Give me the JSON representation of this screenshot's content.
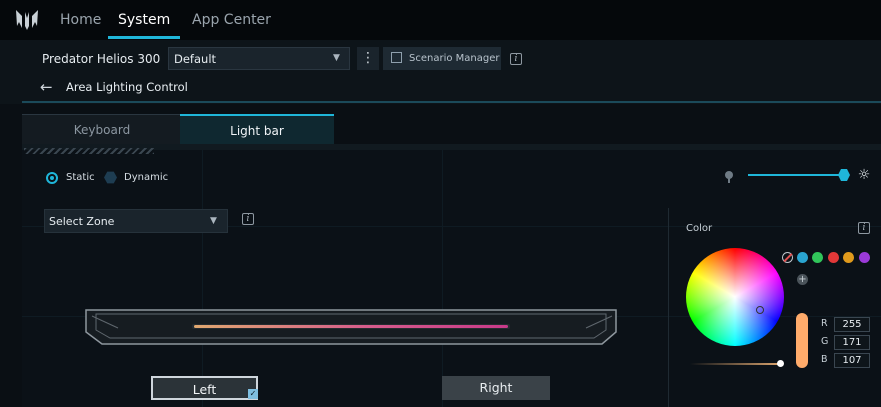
{
  "nav": {
    "tabs": [
      {
        "label": "Home"
      },
      {
        "label": "System"
      },
      {
        "label": "App Center"
      }
    ],
    "active": "System"
  },
  "device": {
    "name": "Predator Helios 300",
    "profile": "Default",
    "scenario_manager": "Scenario Manager"
  },
  "page": {
    "title": "Area Lighting Control"
  },
  "tabs": [
    {
      "label": "Keyboard"
    },
    {
      "label": "Light bar"
    }
  ],
  "active_tab": "Light bar",
  "mode": {
    "options": [
      {
        "label": "Static",
        "selected": true
      },
      {
        "label": "Dynamic",
        "selected": false
      }
    ]
  },
  "brightness": {
    "level": 1.0
  },
  "zone": {
    "placeholder": "Select Zone",
    "buttons": [
      {
        "label": "Left",
        "selected": true
      },
      {
        "label": "Right",
        "selected": false
      }
    ]
  },
  "color": {
    "label": "Color",
    "swatches": [
      "#2aa4d0",
      "#31c55a",
      "#e23838",
      "#e09a1c",
      "#9b3ad8"
    ],
    "rgb": {
      "r_label": "R",
      "g_label": "G",
      "b_label": "B",
      "r": "255",
      "g": "171",
      "b": "107"
    },
    "current": "#ffab6b"
  },
  "accent": "#1fb6d9"
}
